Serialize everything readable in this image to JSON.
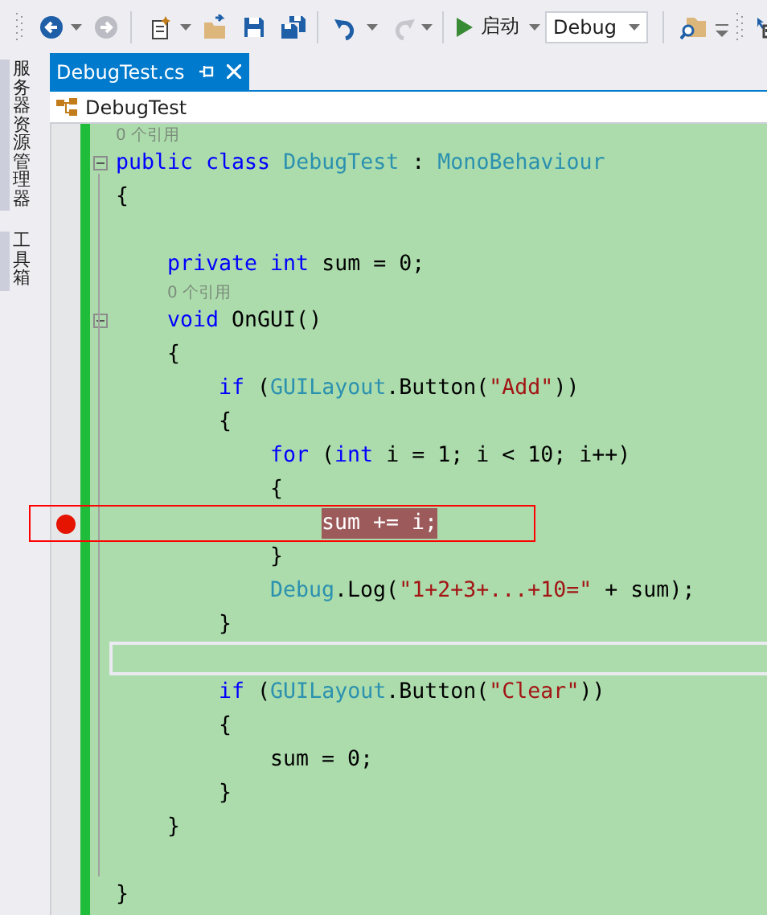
{
  "toolbar": [
    {
      "kind": "grip"
    },
    {
      "kind": "back",
      "disabled": false
    },
    {
      "kind": "caret"
    },
    {
      "kind": "forward",
      "disabled": true
    },
    {
      "kind": "separator"
    },
    {
      "kind": "new-project"
    },
    {
      "kind": "caret"
    },
    {
      "kind": "open"
    },
    {
      "kind": "save"
    },
    {
      "kind": "save-all"
    },
    {
      "kind": "separator"
    },
    {
      "kind": "undo",
      "disabled": false
    },
    {
      "kind": "caret"
    },
    {
      "kind": "redo",
      "disabled": true
    },
    {
      "kind": "caret"
    },
    {
      "kind": "separator"
    },
    {
      "kind": "start",
      "label": "启动"
    },
    {
      "kind": "caret"
    },
    {
      "kind": "combo",
      "value": "Debug"
    },
    {
      "kind": "separator"
    },
    {
      "kind": "find"
    },
    {
      "kind": "overflow"
    },
    {
      "kind": "grip"
    },
    {
      "kind": "partial"
    }
  ],
  "side_tabs": [
    {
      "label": "服务器资源管理器"
    },
    {
      "label": "工具箱"
    }
  ],
  "document_tab": {
    "title": "DebugTest.cs",
    "selected": true
  },
  "navigation_bar": {
    "type": "DebugTest"
  },
  "editor": {
    "annotation": {
      "kind": "rectangle"
    },
    "lines": [
      {
        "kind": "codelens",
        "text": "0 个引用"
      },
      {
        "kind": "fold-start",
        "tokens": [
          {
            "t": "public class ",
            "kind": "keyword"
          },
          {
            "t": "DebugTest",
            "kind": "type"
          },
          {
            "t": " : ",
            "kind": "plain"
          },
          {
            "t": "MonoBehaviour",
            "kind": "type"
          }
        ]
      },
      {
        "kind": "code",
        "tokens": [
          {
            "t": "{",
            "kind": "plain"
          }
        ]
      },
      {
        "kind": "code"
      },
      {
        "kind": "code",
        "tokens": [
          {
            "t": "    private int ",
            "kind": "keyword"
          },
          {
            "t": "sum = 0;",
            "kind": "plain"
          }
        ]
      },
      {
        "kind": "codelens",
        "text": "    0 个引用"
      },
      {
        "kind": "fold-start",
        "tokens": [
          {
            "t": "    void ",
            "kind": "keyword"
          },
          {
            "t": "OnGUI()",
            "kind": "plain"
          }
        ]
      },
      {
        "kind": "code",
        "tokens": [
          {
            "t": "    {",
            "kind": "plain"
          }
        ]
      },
      {
        "kind": "code",
        "tokens": [
          {
            "t": "        if ",
            "kind": "keyword"
          },
          {
            "t": "(",
            "kind": "plain"
          },
          {
            "t": "GUILayout",
            "kind": "type"
          },
          {
            "t": ".Button(",
            "kind": "plain"
          },
          {
            "t": "\"Add\"",
            "kind": "string"
          },
          {
            "t": "))",
            "kind": "plain"
          }
        ]
      },
      {
        "kind": "code",
        "tokens": [
          {
            "t": "        {",
            "kind": "plain"
          }
        ]
      },
      {
        "kind": "code",
        "tokens": [
          {
            "t": "            for ",
            "kind": "keyword"
          },
          {
            "t": "(",
            "kind": "plain"
          },
          {
            "t": "int ",
            "kind": "keyword"
          },
          {
            "t": "i = 1; i < 10; i++)",
            "kind": "plain"
          }
        ]
      },
      {
        "kind": "code",
        "tokens": [
          {
            "t": "            {",
            "kind": "plain"
          }
        ]
      },
      {
        "kind": "breakpoint",
        "tokens": [
          {
            "t": "                sum += i;",
            "kind": "highlight"
          }
        ]
      },
      {
        "kind": "code",
        "tokens": [
          {
            "t": "            }",
            "kind": "plain"
          }
        ]
      },
      {
        "kind": "code",
        "tokens": [
          {
            "t": "            Debug",
            "kind": "type"
          },
          {
            "t": ".Log(",
            "kind": "plain"
          },
          {
            "t": "\"1+2+3+...+10=\"",
            "kind": "string"
          },
          {
            "t": " + sum);",
            "kind": "plain"
          }
        ]
      },
      {
        "kind": "code",
        "tokens": [
          {
            "t": "        }",
            "kind": "plain"
          }
        ]
      },
      {
        "kind": "current-line"
      },
      {
        "kind": "code",
        "tokens": [
          {
            "t": "        if ",
            "kind": "keyword"
          },
          {
            "t": "(",
            "kind": "plain"
          },
          {
            "t": "GUILayout",
            "kind": "type"
          },
          {
            "t": ".Button(",
            "kind": "plain"
          },
          {
            "t": "\"Clear\"",
            "kind": "string"
          },
          {
            "t": "))",
            "kind": "plain"
          }
        ]
      },
      {
        "kind": "code",
        "tokens": [
          {
            "t": "        {",
            "kind": "plain"
          }
        ]
      },
      {
        "kind": "code",
        "tokens": [
          {
            "t": "            sum = 0;",
            "kind": "plain"
          }
        ]
      },
      {
        "kind": "code",
        "tokens": [
          {
            "t": "        }",
            "kind": "plain"
          }
        ]
      },
      {
        "kind": "code",
        "tokens": [
          {
            "t": "    }",
            "kind": "plain"
          }
        ]
      },
      {
        "kind": "code"
      },
      {
        "kind": "code",
        "tokens": [
          {
            "t": "}",
            "kind": "plain"
          }
        ]
      }
    ]
  }
}
